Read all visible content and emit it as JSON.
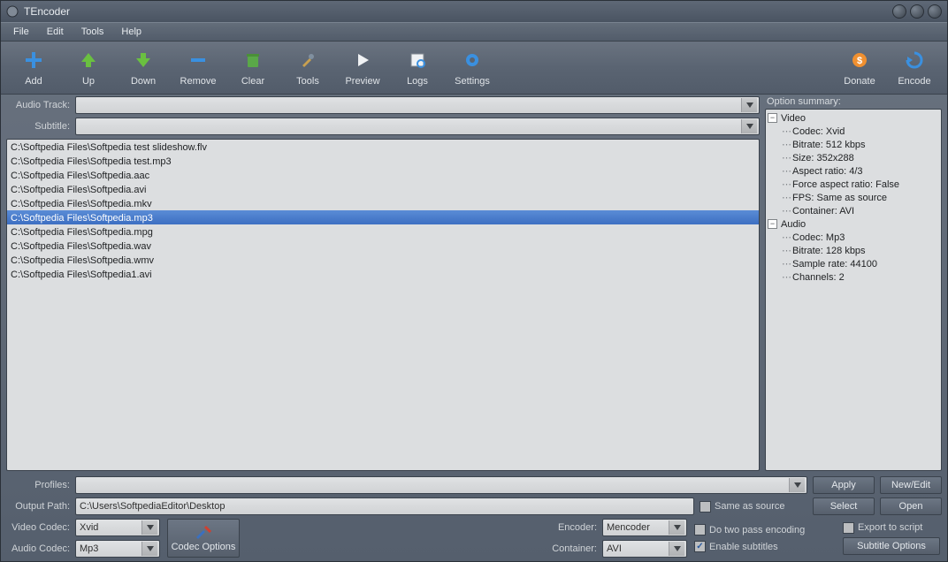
{
  "window": {
    "title": "TEncoder"
  },
  "menu": {
    "items": [
      "File",
      "Edit",
      "Tools",
      "Help"
    ]
  },
  "toolbar": {
    "add": "Add",
    "up": "Up",
    "down": "Down",
    "remove": "Remove",
    "clear": "Clear",
    "tools": "Tools",
    "preview": "Preview",
    "logs": "Logs",
    "settings": "Settings",
    "donate": "Donate",
    "encode": "Encode"
  },
  "labels": {
    "audio_track": "Audio Track:",
    "subtitle": "Subtitle:",
    "option_summary": "Option summary:",
    "profiles": "Profiles:",
    "output_path": "Output Path:",
    "video_codec": "Video Codec:",
    "audio_codec": "Audio Codec:",
    "encoder": "Encoder:",
    "container": "Container:"
  },
  "audio_track_value": "",
  "subtitle_value": "",
  "files": [
    {
      "path": "C:\\Softpedia Files\\Softpedia test slideshow.flv",
      "selected": false
    },
    {
      "path": "C:\\Softpedia Files\\Softpedia test.mp3",
      "selected": false
    },
    {
      "path": "C:\\Softpedia Files\\Softpedia.aac",
      "selected": false
    },
    {
      "path": "C:\\Softpedia Files\\Softpedia.avi",
      "selected": false
    },
    {
      "path": "C:\\Softpedia Files\\Softpedia.mkv",
      "selected": false
    },
    {
      "path": "C:\\Softpedia Files\\Softpedia.mp3",
      "selected": true
    },
    {
      "path": "C:\\Softpedia Files\\Softpedia.mpg",
      "selected": false
    },
    {
      "path": "C:\\Softpedia Files\\Softpedia.wav",
      "selected": false
    },
    {
      "path": "C:\\Softpedia Files\\Softpedia.wmv",
      "selected": false
    },
    {
      "path": "C:\\Softpedia Files\\Softpedia1.avi",
      "selected": false
    }
  ],
  "summary": {
    "video_label": "Video",
    "audio_label": "Audio",
    "video": {
      "codec": "Codec: Xvid",
      "bitrate": "Bitrate: 512 kbps",
      "size": "Size: 352x288",
      "aspect": "Aspect ratio: 4/3",
      "force_aspect": "Force aspect ratio: False",
      "fps": "FPS: Same as source",
      "container": "Container: AVI"
    },
    "audio": {
      "codec": "Codec: Mp3",
      "bitrate": "Bitrate: 128 kbps",
      "sample_rate": "Sample rate: 44100",
      "channels": "Channels: 2"
    }
  },
  "profiles_value": "",
  "output_path": "C:\\Users\\SoftpediaEditor\\Desktop",
  "video_codec": "Xvid",
  "audio_codec": "Mp3",
  "encoder": "Mencoder",
  "container": "AVI",
  "buttons": {
    "apply": "Apply",
    "new_edit": "New/Edit",
    "select": "Select",
    "open": "Open",
    "codec_options": "Codec Options",
    "subtitle_options": "Subtitle Options"
  },
  "checks": {
    "same_as_source": "Same as source",
    "two_pass": "Do two pass encoding",
    "export_script": "Export to script",
    "enable_subtitles": "Enable subtitles"
  },
  "enable_subtitles_checked": true
}
